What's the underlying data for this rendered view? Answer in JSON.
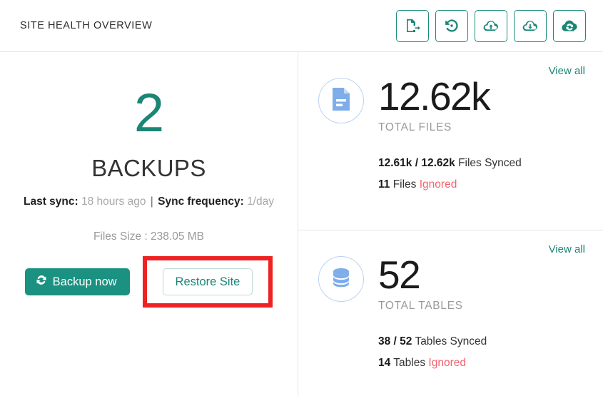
{
  "header": {
    "title": "SITE HEALTH OVERVIEW",
    "toolbar": [
      {
        "name": "export-site-icon",
        "label": "Export Site",
        "active": false
      },
      {
        "name": "restore-history-icon",
        "label": "Restore History",
        "active": false
      },
      {
        "name": "cloud-upload-icon",
        "label": "Push to Cloud",
        "active": false
      },
      {
        "name": "cloud-download-icon",
        "label": "Pull from Cloud",
        "active": false
      },
      {
        "name": "cloud-sync-icon",
        "label": "Cloud Sync",
        "active": true
      }
    ]
  },
  "backups": {
    "count": "2",
    "label": "BACKUPS",
    "last_sync_label": "Last sync:",
    "last_sync_value": "18 hours ago",
    "separator": "|",
    "sync_frequency_label": "Sync frequency:",
    "sync_frequency_value": "1/day",
    "files_size": "Files Size : 238.05 MB",
    "backup_button": "Backup now",
    "restore_button": "Restore Site"
  },
  "stats": [
    {
      "view_all": "View all",
      "icon": "document-icon",
      "number": "12.62k",
      "caption": "TOTAL FILES",
      "synced_count": "12.61k / 12.62k",
      "synced_text": "Files Synced",
      "ignored_count": "11",
      "ignored_unit": "Files",
      "ignored_text": "Ignored"
    },
    {
      "view_all": "View all",
      "icon": "database-icon",
      "number": "52",
      "caption": "TOTAL TABLES",
      "synced_count": "38 / 52",
      "synced_text": "Tables Synced",
      "ignored_count": "14",
      "ignored_unit": "Tables",
      "ignored_text": "Ignored"
    }
  ],
  "colors": {
    "teal": "#1b8576",
    "teal_button": "#1a9181",
    "icon_blue": "#7eaeea",
    "ignored_red": "#f4626e",
    "highlight_red": "#ee2222"
  }
}
